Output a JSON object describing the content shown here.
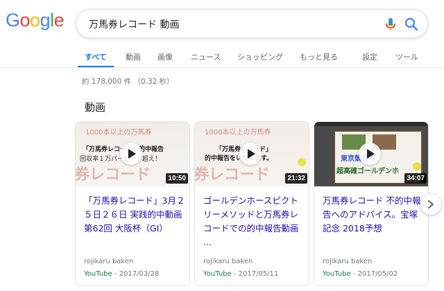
{
  "logo": {
    "letters": [
      "G",
      "o",
      "o",
      "g",
      "l",
      "e"
    ],
    "colors": [
      "#4285f4",
      "#ea4335",
      "#fbbc05",
      "#4285f4",
      "#34a853",
      "#ea4335"
    ]
  },
  "search": {
    "query": "万馬券レコード 動画"
  },
  "tabs": [
    {
      "label": "すべて",
      "active": true
    },
    {
      "label": "動画"
    },
    {
      "label": "画像"
    },
    {
      "label": "ニュース"
    },
    {
      "label": "ショッピング"
    },
    {
      "label": "もっと見る"
    },
    {
      "label": "設定"
    },
    {
      "label": "ツール"
    }
  ],
  "result_stats": "約 178,000 件 （0.32 秒）",
  "section_title": "動画",
  "videos": [
    {
      "title": "「万馬券レコード」3月２５日２６日 実践的中動画 第62回 大阪杯（GI）",
      "duration": "10:50",
      "channel": "rojikaru baken",
      "source": "YouTube",
      "date": " - 2017/03/28",
      "thumb_lines": [
        "1000本以上の万馬券",
        "「万馬券レコード」的中報告",
        "回収率１万パーセント超え！",
        "券レコード"
      ]
    },
    {
      "title": "ゴールデンホースピクトリーメソッドと万馬券レコードでの的中報告動画 ...",
      "duration": "21:32",
      "channel": "rojikaru baken",
      "source": "YouTube",
      "date": " - 2017/05/11",
      "thumb_lines": [
        "1000本以上の万馬券",
        "「万馬券レコード」",
        "的中報告をいたします。",
        "券レコード"
      ]
    },
    {
      "title": "万馬券レコード 不的中報告へのアドバイス。宝塚記念 2018予想",
      "duration": "34:07",
      "channel": "rojikaru baken",
      "source": "YouTube",
      "date": " - 2017/05/02",
      "thumb_lines": [
        "東京競馬場",
        "超高確ゴールデンホ"
      ]
    }
  ],
  "icons": {
    "mic": "mic-icon",
    "search": "search-icon",
    "next": "chevron-right-icon",
    "play": "play-icon"
  }
}
